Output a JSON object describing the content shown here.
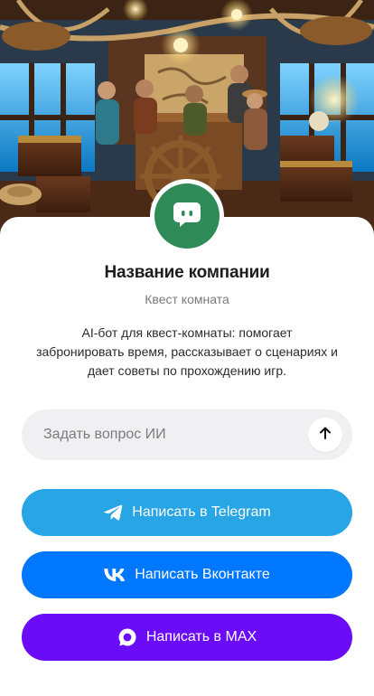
{
  "hero": {
    "icon": "quest-room-illustration"
  },
  "avatar": {
    "icon": "chat-bot-icon",
    "color": "#2e8b57"
  },
  "company": {
    "title": "Название компании",
    "subtitle": "Квест комната",
    "description": "AI-бот для квест-комнаты: помогает забронировать время, рассказывает о сценариях и дает советы по прохождению игр."
  },
  "ask": {
    "placeholder": "Задать вопрос ИИ",
    "value": "",
    "send_icon": "arrow-up-icon"
  },
  "buttons": {
    "telegram": {
      "label": "Написать в Telegram",
      "icon": "telegram-icon",
      "color": "#27a5e4"
    },
    "vk": {
      "label": "Написать Вконтакте",
      "icon": "vk-icon",
      "color": "#0077ff"
    },
    "max": {
      "label": "Написать в MAX",
      "icon": "max-icon",
      "color": "#6a0cf7"
    }
  }
}
